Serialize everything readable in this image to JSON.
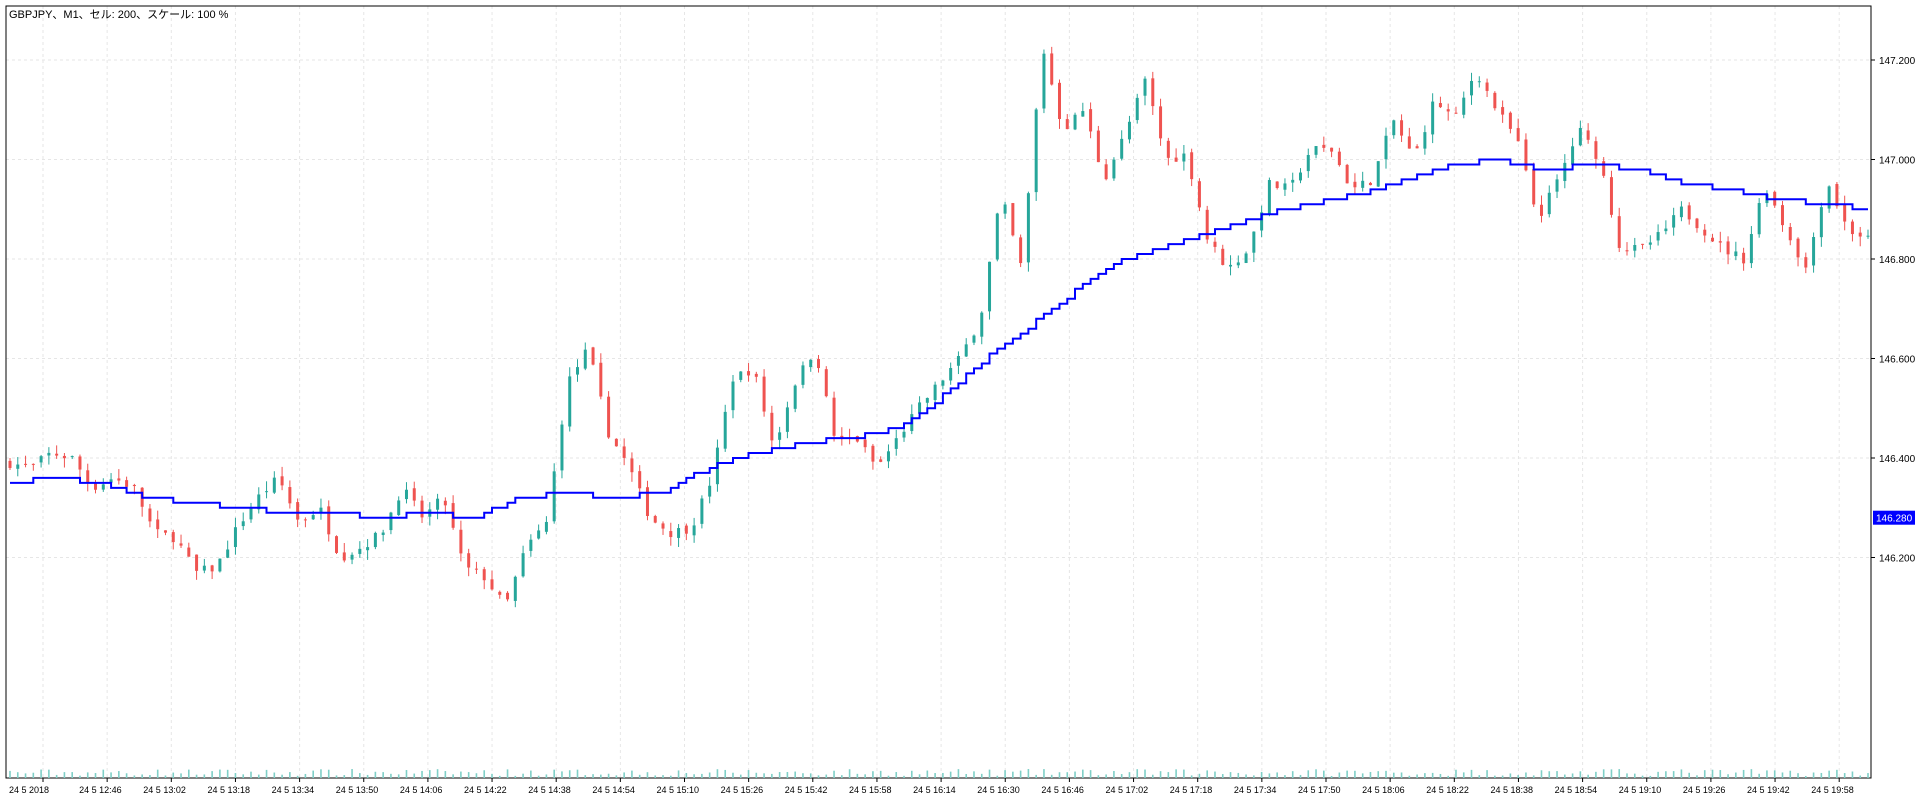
{
  "chart_data": {
    "type": "candlestick",
    "title": "GBPJPY、M1、セル: 200、スケール: 100 %",
    "symbol": "GBPJPY",
    "timeframe": "M1",
    "ylim": [
      146.0,
      147.4
    ],
    "grid": true,
    "colors": {
      "background": "#ffffff",
      "up": "#26a69a",
      "down": "#ef5350",
      "ma_line": "#0000ff",
      "grid": "#e6e6e6",
      "price_label_bg": "#0000ff",
      "volume": "#7fcfc7"
    },
    "y_ticks": [
      {
        "value": 146.2,
        "label": "146.200"
      },
      {
        "value": 146.4,
        "label": "146.400"
      },
      {
        "value": 146.6,
        "label": "146.600"
      },
      {
        "value": 146.8,
        "label": "146.800"
      },
      {
        "value": 147.0,
        "label": "147.000"
      },
      {
        "value": 147.2,
        "label": "147.200"
      }
    ],
    "current_price": {
      "value": 146.28,
      "label": "146.280"
    },
    "x_ticks": [
      "24 5 2018",
      "24 5 12:46",
      "24 5 13:02",
      "24 5 13:18",
      "24 5 13:34",
      "24 5 13:50",
      "24 5 14:06",
      "24 5 14:22",
      "24 5 14:38",
      "24 5 14:54",
      "24 5 15:10",
      "24 5 15:26",
      "24 5 15:42",
      "24 5 15:58",
      "24 5 16:14",
      "24 5 16:30",
      "24 5 16:46",
      "24 5 17:02",
      "24 5 17:18",
      "24 5 17:34",
      "24 5 17:50",
      "24 5 18:06",
      "24 5 18:22",
      "24 5 18:38",
      "24 5 18:54",
      "24 5 19:10",
      "24 5 19:26",
      "24 5 19:42",
      "24 5 19:58"
    ],
    "close_path": [
      146.39,
      146.38,
      146.41,
      146.4,
      146.34,
      146.36,
      146.34,
      146.25,
      146.24,
      146.17,
      146.18,
      146.26,
      146.32,
      146.36,
      146.27,
      146.3,
      146.2,
      146.22,
      146.25,
      146.34,
      146.28,
      146.32,
      146.18,
      146.16,
      146.1,
      146.22,
      146.27,
      146.55,
      146.62,
      146.45,
      146.38,
      146.28,
      146.25,
      146.26,
      146.36,
      146.56,
      146.58,
      146.42,
      146.55,
      146.62,
      146.43,
      146.44,
      146.38,
      146.44,
      146.5,
      146.55,
      146.6,
      146.68,
      146.93,
      146.78,
      147.23,
      147.06,
      147.1,
      146.96,
      147.05,
      147.16,
      147.0,
      147.01,
      146.84,
      146.78,
      146.82,
      146.95,
      146.94,
      147.02,
      147.02,
      146.94,
      146.96,
      147.08,
      147.0,
      147.12,
      147.08,
      147.18,
      147.1,
      147.04,
      146.88,
      146.96,
      147.06,
      147.0,
      146.82,
      146.82,
      146.85,
      146.9,
      146.86,
      146.82,
      146.8,
      146.95,
      146.86,
      146.78,
      146.96,
      146.86,
      146.84
    ],
    "ma_path": [
      146.35,
      146.36,
      146.35,
      146.32,
      146.31,
      146.3,
      146.29,
      146.29,
      146.28,
      146.29,
      146.28,
      146.32,
      146.33,
      146.32,
      146.33,
      146.38,
      146.41,
      146.43,
      146.44,
      146.46,
      146.52,
      146.6,
      146.67,
      146.74,
      146.8,
      146.83,
      146.86,
      146.89,
      146.91,
      146.93,
      146.96,
      146.99,
      147.0,
      146.98,
      146.99,
      146.98,
      146.95,
      146.94,
      146.92,
      146.91,
      146.9
    ]
  }
}
